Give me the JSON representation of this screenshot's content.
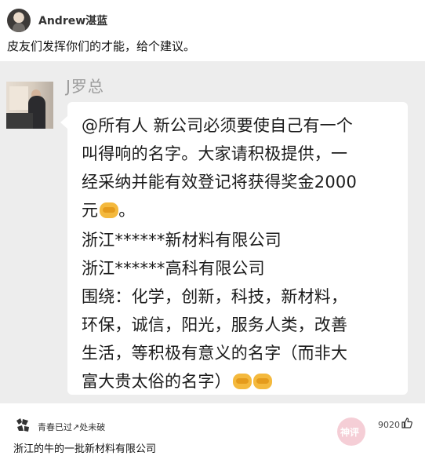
{
  "post": {
    "author": "Andrew湛蓝",
    "text": "皮友们发挥你们的才能，给个建议。"
  },
  "chat": {
    "sender": "J罗总",
    "message_lines": [
      "@所有人 新公司必须要使自己有一个",
      "叫得响的名字。大家请积极提供，一",
      "经采纳并能有效登记将获得奖金2000",
      "元",
      "浙江******新材料有限公司",
      "浙江******高科有限公司",
      "围绕：化学，创新，科技，新材料，",
      "环保，诚信，阳光，服务人类，改善",
      "生活，等积极有意义的名字（而非大",
      "富大贵太俗的名字）"
    ],
    "emoji_icon": "handshake-emoji-icon"
  },
  "comment": {
    "author": "青春已过↗处未破",
    "likes": "9020",
    "like_icon": "thumbs-up-icon",
    "text": "浙江的牛的一批新材料有限公司",
    "watermark_text": "神评",
    "watermark_color": "#f4c6cf"
  }
}
